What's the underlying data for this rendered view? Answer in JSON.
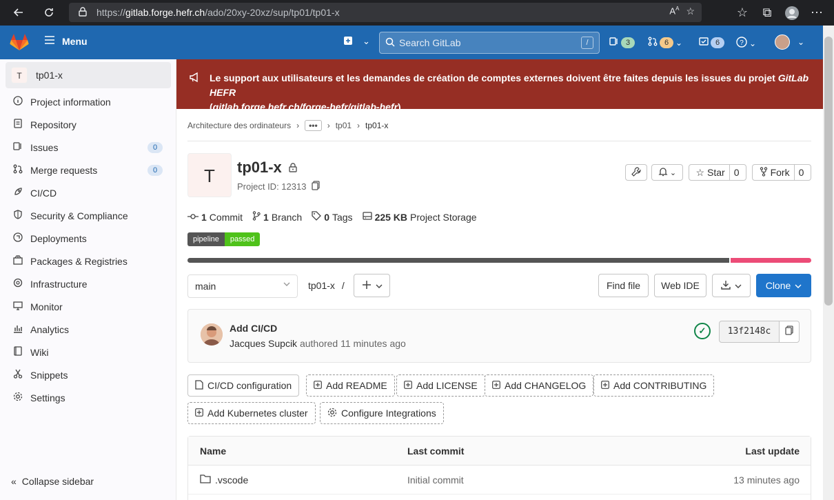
{
  "browser": {
    "url_prefix": "https://",
    "url_host": "gitlab.forge.hefr.ch",
    "url_path": "/ado/20xy-20xz/sup/tp01/tp01-x"
  },
  "header": {
    "menu_label": "Menu",
    "search_placeholder": "Search GitLab",
    "search_shortcut": "/",
    "issues_count": "3",
    "mr_count": "6",
    "todos_count": "6"
  },
  "sidebar": {
    "project_avatar": "T",
    "project_name": "tp01-x",
    "items": [
      {
        "label": "Project information",
        "icon": "info-icon"
      },
      {
        "label": "Repository",
        "icon": "doc-icon"
      },
      {
        "label": "Issues",
        "icon": "issues-icon",
        "badge": "0"
      },
      {
        "label": "Merge requests",
        "icon": "merge-icon",
        "badge": "0"
      },
      {
        "label": "CI/CD",
        "icon": "rocket-icon"
      },
      {
        "label": "Security & Compliance",
        "icon": "shield-icon"
      },
      {
        "label": "Deployments",
        "icon": "deploy-icon"
      },
      {
        "label": "Packages & Registries",
        "icon": "package-icon"
      },
      {
        "label": "Infrastructure",
        "icon": "cloud-icon"
      },
      {
        "label": "Monitor",
        "icon": "monitor-icon"
      },
      {
        "label": "Analytics",
        "icon": "chart-icon"
      },
      {
        "label": "Wiki",
        "icon": "book-icon"
      },
      {
        "label": "Snippets",
        "icon": "scissors-icon"
      },
      {
        "label": "Settings",
        "icon": "gear-icon"
      }
    ],
    "collapse_label": "Collapse sidebar"
  },
  "banner": {
    "text_main": "Le support aux utilisateurs et les demandes de création de comptes externes doivent être faites depuis les issues du projet ",
    "text_em": "GitLab HEFR",
    "link_open": "(",
    "link": "gitlab.forge.hefr.ch/forge-hefr/gitlab-hefr",
    "link_close": ")"
  },
  "breadcrumb": {
    "first": "Architecture des ordinateurs",
    "dots": "•••",
    "second": "tp01",
    "current": "tp01-x"
  },
  "project": {
    "avatar": "T",
    "name": "tp01-x",
    "id_label": "Project ID: 12313",
    "star_label": "Star",
    "star_count": "0",
    "fork_label": "Fork",
    "fork_count": "0"
  },
  "stats": {
    "commits_count": "1",
    "commits_label": "Commit",
    "branches_count": "1",
    "branches_label": "Branch",
    "tags_count": "0",
    "tags_label": "Tags",
    "storage_size": "225 KB",
    "storage_label": "Project Storage"
  },
  "pipeline_badge": {
    "left": "pipeline",
    "right": "passed"
  },
  "languages": [
    {
      "color": "#555555",
      "fraction": 0.87
    },
    {
      "color": "#ec4c77",
      "fraction": 0.13
    }
  ],
  "repo_nav": {
    "branch": "main",
    "path": "tp01-x",
    "path_sep": "/",
    "find_file": "Find file",
    "web_ide": "Web IDE",
    "clone": "Clone"
  },
  "last_commit": {
    "title": "Add CI/CD",
    "author": "Jacques Supcik",
    "meta": " authored 11 minutes ago",
    "sha": "13f2148c"
  },
  "quick_actions": [
    "CI/CD configuration",
    "Add README",
    "Add LICENSE",
    "Add CHANGELOG",
    "Add CONTRIBUTING",
    "Add Kubernetes cluster",
    "Configure Integrations"
  ],
  "file_table": {
    "headers": [
      "Name",
      "Last commit",
      "Last update"
    ],
    "rows": [
      {
        "name": ".vscode",
        "commit": "Initial commit",
        "updated": "13 minutes ago"
      }
    ]
  },
  "colors": {
    "header": "#1f68b0",
    "banner": "#962e24",
    "clone_btn": "#1f75cb",
    "pipeline_passed": "#4fc21a",
    "status_ok": "#108548"
  }
}
